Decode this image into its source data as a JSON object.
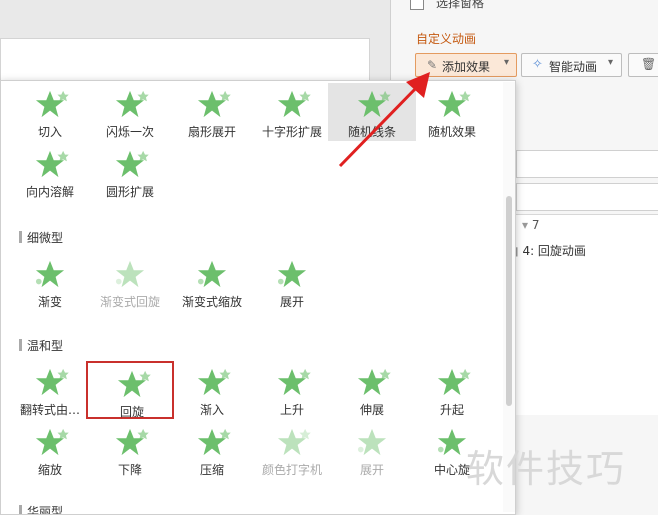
{
  "panel": {
    "selection_pane": "选择窗格",
    "custom_animation_title": "自定义动画",
    "add_effect_label": "添加效果",
    "smart_animation_label": "智能动画",
    "list_index": "7",
    "list_item_text": "4: 回旋动画"
  },
  "dropdown": {
    "group1": [
      {
        "label": "切入",
        "icon": "star-cut-in-icon"
      },
      {
        "label": "闪烁一次",
        "icon": "star-flash-icon"
      },
      {
        "label": "扇形展开",
        "icon": "star-fan-icon"
      },
      {
        "label": "十字形扩展",
        "icon": "star-plus-icon"
      },
      {
        "label": "随机线条",
        "icon": "star-lines-icon"
      },
      {
        "label": "随机效果",
        "icon": "star-random-icon"
      },
      {
        "label": "向内溶解",
        "icon": "star-dissolve-icon"
      },
      {
        "label": "圆形扩展",
        "icon": "star-circle-icon"
      }
    ],
    "sections": {
      "subtle": "细微型",
      "moderate": "温和型",
      "exciting": "华丽型"
    },
    "subtle_items": [
      {
        "label": "渐变",
        "icon": "star-fade-icon"
      },
      {
        "label": "渐变式回旋",
        "icon": "star-fade-swivel-icon",
        "disabled": true
      },
      {
        "label": "渐变式缩放",
        "icon": "star-fade-zoom-icon"
      },
      {
        "label": "展开",
        "icon": "star-expand-icon"
      }
    ],
    "moderate_items": [
      {
        "label": "翻转式由…",
        "icon": "star-flip-icon"
      },
      {
        "label": "回旋",
        "icon": "star-swivel-icon"
      },
      {
        "label": "渐入",
        "icon": "star-ease-in-icon"
      },
      {
        "label": "上升",
        "icon": "star-ascend-icon"
      },
      {
        "label": "伸展",
        "icon": "star-stretch-icon"
      },
      {
        "label": "升起",
        "icon": "star-rise-icon"
      },
      {
        "label": "缩放",
        "icon": "star-zoom-icon"
      },
      {
        "label": "下降",
        "icon": "star-descend-icon"
      },
      {
        "label": "压缩",
        "icon": "star-compress-icon"
      },
      {
        "label": "颜色打字机",
        "icon": "star-typewriter-icon",
        "disabled": true
      },
      {
        "label": "展开",
        "icon": "star-unfold-icon",
        "disabled": true
      },
      {
        "label": "中心旋",
        "icon": "star-center-spin-icon"
      }
    ]
  },
  "watermark": "软件技巧",
  "colors": {
    "star": "#6cbf6c",
    "accent": "#c55a11",
    "arrow": "#e02020"
  }
}
